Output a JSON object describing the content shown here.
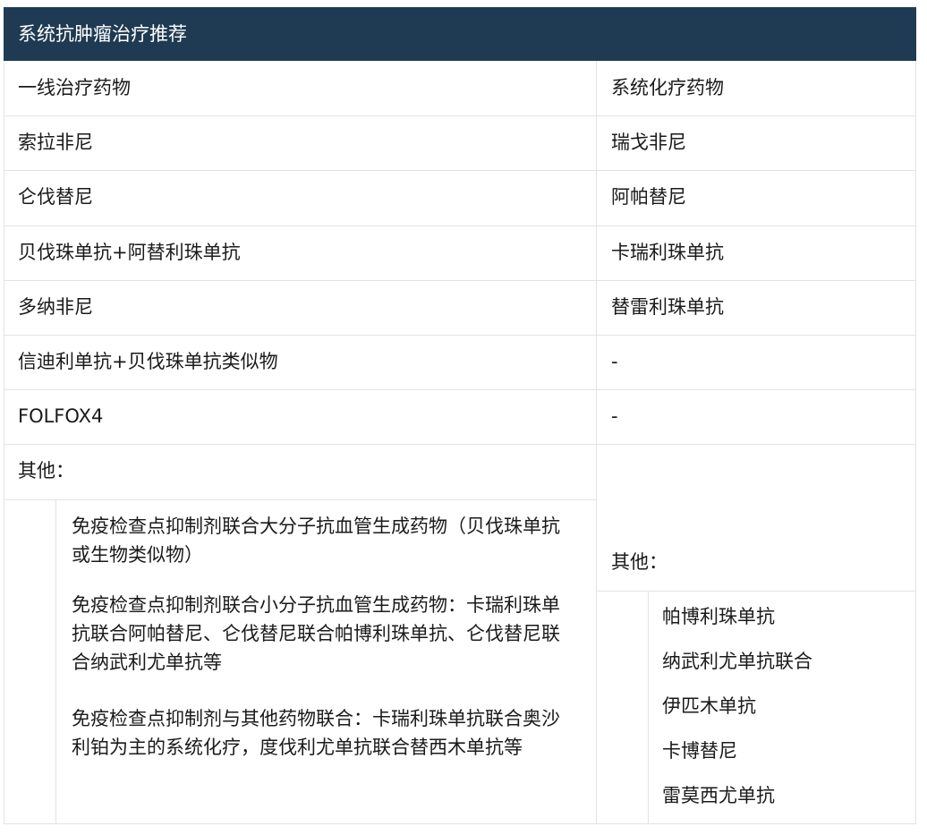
{
  "table": {
    "title": "系统抗肿瘤治疗推荐",
    "left_header": "一线治疗药物",
    "right_header": "系统化疗药物",
    "rows": [
      {
        "left": "索拉非尼",
        "right": "瑞戈非尼"
      },
      {
        "left": "仑伐替尼",
        "right": "阿帕替尼"
      },
      {
        "left": "贝伐珠单抗+阿替利珠单抗",
        "right": "卡瑞利珠单抗"
      },
      {
        "left": "多纳非尼",
        "right": "替雷利珠单抗"
      },
      {
        "left": "信迪利单抗+贝伐珠单抗类似物",
        "right": "-"
      },
      {
        "left": "FOLFOX4",
        "right": "-"
      }
    ],
    "left_other": {
      "label": "其他：",
      "items": [
        "免疫检查点抑制剂联合大分子抗血管生成药物（贝伐珠单抗或生物类似物）",
        "免疫检查点抑制剂联合小分子抗血管生成药物：卡瑞利珠单抗联合阿帕替尼、仑伐替尼联合帕博利珠单抗、仑伐替尼联合纳武利尤单抗等",
        "免疫检查点抑制剂与其他药物联合：卡瑞利珠单抗联合奥沙利铂为主的系统化疗，度伐利尤单抗联合替西木单抗等"
      ]
    },
    "right_other": {
      "label": "其他：",
      "items": [
        "帕博利珠单抗",
        "纳武利尤单抗联合",
        "伊匹木单抗",
        "卡博替尼",
        "雷莫西尤单抗"
      ]
    }
  }
}
